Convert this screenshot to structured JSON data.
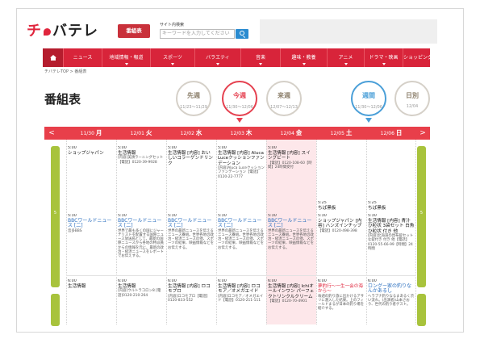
{
  "header": {
    "logo_prefix": "チ",
    "logo_rest": "バテレ",
    "program_button": "番組表",
    "search_label": "サイト内検索",
    "search_placeholder": "キーワードを入力してください"
  },
  "nav": {
    "items": [
      {
        "label": "ニュース",
        "dropdown": false
      },
      {
        "label": "地域情報・報道",
        "dropdown": true
      },
      {
        "label": "スポーツ",
        "dropdown": true
      },
      {
        "label": "バラエティ",
        "dropdown": true
      },
      {
        "label": "音楽",
        "dropdown": true
      },
      {
        "label": "趣味・教養",
        "dropdown": true
      },
      {
        "label": "アニメ",
        "dropdown": true
      },
      {
        "label": "ドラマ・映画",
        "dropdown": true
      },
      {
        "label": "ショッピング",
        "dropdown": false
      }
    ]
  },
  "breadcrumb": "チバテレTOP > 番組表",
  "page_title": "番組表",
  "weeks": [
    {
      "label": "先週",
      "range": "11/23〜11/29",
      "style": "gray"
    },
    {
      "label": "今週",
      "range": "11/30〜12/06",
      "style": "red"
    },
    {
      "label": "来週",
      "range": "12/07〜12/13",
      "style": "gray"
    },
    {
      "label": "週間",
      "range": "11/30〜12/06",
      "style": "blue"
    },
    {
      "label": "日別",
      "range": "12/04",
      "style": "gray"
    }
  ],
  "days": [
    {
      "date": "11/30",
      "wd": "月"
    },
    {
      "date": "12/01",
      "wd": "火"
    },
    {
      "date": "12/02",
      "wd": "水"
    },
    {
      "date": "12/03",
      "wd": "木"
    },
    {
      "date": "12/04",
      "wd": "金"
    },
    {
      "date": "12/05",
      "wd": "土"
    },
    {
      "date": "12/06",
      "wd": "日"
    }
  ],
  "arrows": {
    "prev": "<",
    "next": ">"
  },
  "side_label": "5",
  "programs": {
    "row1": [
      {
        "time": "5:00",
        "title": "ショップジャパン",
        "desc": ""
      },
      {
        "time": "5:00",
        "title": "生活情報",
        "desc": "[内容]美顔ラーニングセット【電話】0120-39-9928"
      },
      {
        "time": "5:00",
        "title": "生活情報 [内容] おいしいコラーゲンドリンク",
        "desc": ""
      },
      {
        "time": "5:00",
        "title": "生活情報 [内容] Aluca Luceクッションファンデーション",
        "desc": "[内容]Aluca Luceクッションファンデーション【電話】0120-22-7777"
      },
      {
        "time": "5:00",
        "title": "生活情報 [内容] スイングビート",
        "desc": "【電話】0120-108-60【時間】24時間受付"
      },
      {
        "time": "",
        "title": "",
        "desc": ""
      },
      {
        "time": "",
        "title": "",
        "desc": ""
      }
    ],
    "row2": [
      {
        "time": "5:30",
        "title": "BBCワールドニュース [二]",
        "desc": "音多BBS"
      },
      {
        "time": "5:30",
        "title": "BBCワールドニュース [二]",
        "desc": "世界で最も多くの国にジャーナリストを配置する国際ニュース放送局として、最新の国際ニュースから各地の特派員からの情報を元に、最新の政治・経済ニュースをレポートでお伝えする。"
      },
      {
        "time": "5:30",
        "title": "BBCワールドニュース [二]",
        "desc": "世界の最新ニュースを伝えるニュース番組。世界各地の政治・経済ニュースの他、スポーツの結果、映画情報などをお伝えする。"
      },
      {
        "time": "5:30",
        "title": "BBCワールドニュース [二]",
        "desc": "世界の最新ニュースを伝えるニュース番組。世界各地の政治・経済ニュースの他、スポーツの結果、映画情報などをお伝えする。"
      },
      {
        "time": "5:30",
        "title": "BBCワールドニュース [二]",
        "desc": "世界の最新ニュースを伝えるニュース番組。世界各地の政治・経済ニュースの他、スポーツの結果、映画情報などをお伝えする。"
      },
      {
        "time": "5:25",
        "title": "ちば黒板",
        "desc": "",
        "time2": "5:30",
        "title2": "ショップジャパン [内容] ハンズインチップ",
        "desc2": "【電話】0120-498-398"
      },
      {
        "time": "5:25",
        "title": "ちば黒板",
        "desc": "",
        "time2": "5:30",
        "title2": "生活情報 [内容] 青汁 ひ粒状 3袋セット 白魚ひ粒状 付き 他",
        "desc2": "[内容]北海道の昆布錠セットな錠付き 付き 他【電話】0120-55-66-99【時間】24時間"
      }
    ],
    "row3": [
      {
        "time": "6:00",
        "title": "生活情報",
        "desc": ""
      },
      {
        "time": "6:00",
        "title": "生活情報",
        "desc": "[内容]ウルトラコロン8 [電話]0120-210-264"
      },
      {
        "time": "6:00",
        "title": "生活情報 [内容] ロコモプロ",
        "desc": "[内容]ロコモプロ【電話】0120-833-552"
      },
      {
        "time": "6:00",
        "title": "生活情報 [内容] ロコモア／オメガエイド",
        "desc": "[内容]ロコモア／オメガエイド【電話】0120-211-111"
      },
      {
        "time": "6:00",
        "title": "生活情報 [内容] Ichiオールインワン パーフェクトリンクルクリーム",
        "desc": "【電話】0120-70-4901"
      },
      {
        "time": "6:00",
        "title": "夢釣行～一生一会の海から～",
        "desc": "毎週の釣り旅に出かけるアサリに潜入した結果。上のフィールドまるが日本の釣り場を紹介する。",
        "red": true
      },
      {
        "time": "6:00",
        "title": "ロングー家の釣りなんかあるし",
        "desc": "ヘラブナ釣りなるまあるく渋い流れ。(出演者)山本さおり、世代の釣り者ゲスト。",
        "blue": true
      }
    ]
  }
}
